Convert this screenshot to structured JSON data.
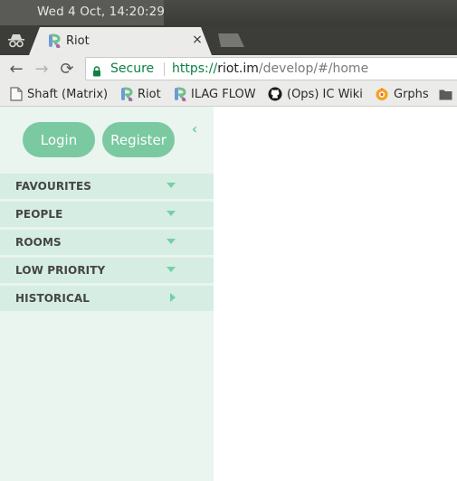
{
  "os": {
    "clock": "Wed  4 Oct, 14:20:29"
  },
  "browser": {
    "tab": {
      "title": "Riot",
      "close_glyph": "×"
    },
    "nav": {
      "back": "←",
      "forward": "→",
      "reload": "⟳"
    },
    "omnibox": {
      "security_label": "Secure",
      "url_scheme": "https://",
      "url_host": "riot.im",
      "url_path": "/develop/#/home"
    },
    "bookmarks": [
      {
        "label": "Shaft (Matrix)",
        "icon": "page-icon"
      },
      {
        "label": "Riot",
        "icon": "riot-icon"
      },
      {
        "label": "ILAG FLOW",
        "icon": "riot-icon"
      },
      {
        "label": "(Ops) IC Wiki",
        "icon": "github-icon"
      },
      {
        "label": "Grphs",
        "icon": "grafana-icon"
      },
      {
        "label": "",
        "icon": "folder-icon"
      }
    ]
  },
  "riot": {
    "login_label": "Login",
    "register_label": "Register",
    "collapse_glyph": "‹",
    "sections": [
      {
        "label": "FAVOURITES",
        "state": "expanded"
      },
      {
        "label": "PEOPLE",
        "state": "expanded"
      },
      {
        "label": "ROOMS",
        "state": "expanded"
      },
      {
        "label": "LOW PRIORITY",
        "state": "expanded"
      },
      {
        "label": "HISTORICAL",
        "state": "collapsed"
      }
    ]
  },
  "colors": {
    "accent": "#76cfa6",
    "button": "#7ac9a1",
    "sidebar_bg": "#eaf5f0",
    "section_bg": "#d5ede2",
    "secure_green": "#0b8043"
  }
}
